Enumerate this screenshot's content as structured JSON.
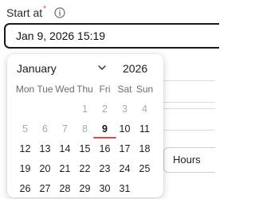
{
  "field": {
    "label": "Start at",
    "required_mark": "*",
    "value": "Jan 9, 2026 15:19"
  },
  "calendar": {
    "month": "January",
    "year": "2026",
    "weekdays": [
      "Mon",
      "Tue",
      "Wed",
      "Thu",
      "Fri",
      "Sat",
      "Sun"
    ],
    "weeks": [
      [
        {
          "d": "",
          "muted": false,
          "sel": false
        },
        {
          "d": "",
          "muted": false,
          "sel": false
        },
        {
          "d": "",
          "muted": false,
          "sel": false
        },
        {
          "d": "1",
          "muted": true,
          "sel": false
        },
        {
          "d": "2",
          "muted": true,
          "sel": false
        },
        {
          "d": "3",
          "muted": true,
          "sel": false
        },
        {
          "d": "4",
          "muted": true,
          "sel": false
        }
      ],
      [
        {
          "d": "5",
          "muted": true,
          "sel": false
        },
        {
          "d": "6",
          "muted": true,
          "sel": false
        },
        {
          "d": "7",
          "muted": true,
          "sel": false
        },
        {
          "d": "8",
          "muted": true,
          "sel": false
        },
        {
          "d": "9",
          "muted": false,
          "sel": true
        },
        {
          "d": "10",
          "muted": false,
          "sel": false
        },
        {
          "d": "11",
          "muted": false,
          "sel": false
        }
      ],
      [
        {
          "d": "12",
          "muted": false,
          "sel": false
        },
        {
          "d": "13",
          "muted": false,
          "sel": false
        },
        {
          "d": "14",
          "muted": false,
          "sel": false
        },
        {
          "d": "15",
          "muted": false,
          "sel": false
        },
        {
          "d": "16",
          "muted": false,
          "sel": false
        },
        {
          "d": "17",
          "muted": false,
          "sel": false
        },
        {
          "d": "18",
          "muted": false,
          "sel": false
        }
      ],
      [
        {
          "d": "19",
          "muted": false,
          "sel": false
        },
        {
          "d": "20",
          "muted": false,
          "sel": false
        },
        {
          "d": "21",
          "muted": false,
          "sel": false
        },
        {
          "d": "22",
          "muted": false,
          "sel": false
        },
        {
          "d": "23",
          "muted": false,
          "sel": false
        },
        {
          "d": "24",
          "muted": false,
          "sel": false
        },
        {
          "d": "25",
          "muted": false,
          "sel": false
        }
      ],
      [
        {
          "d": "26",
          "muted": false,
          "sel": false
        },
        {
          "d": "27",
          "muted": false,
          "sel": false
        },
        {
          "d": "28",
          "muted": false,
          "sel": false
        },
        {
          "d": "29",
          "muted": false,
          "sel": false
        },
        {
          "d": "30",
          "muted": false,
          "sel": false
        },
        {
          "d": "31",
          "muted": false,
          "sel": false
        },
        {
          "d": "",
          "muted": false,
          "sel": false
        }
      ]
    ]
  },
  "background": {
    "hours_label": "Hours"
  },
  "colors": {
    "accent": "#e0464a",
    "text": "#1c1c1c",
    "muted": "#a9a9a9"
  },
  "icons": {
    "info": "info-icon",
    "month_dropdown": "chevron-down-icon"
  }
}
